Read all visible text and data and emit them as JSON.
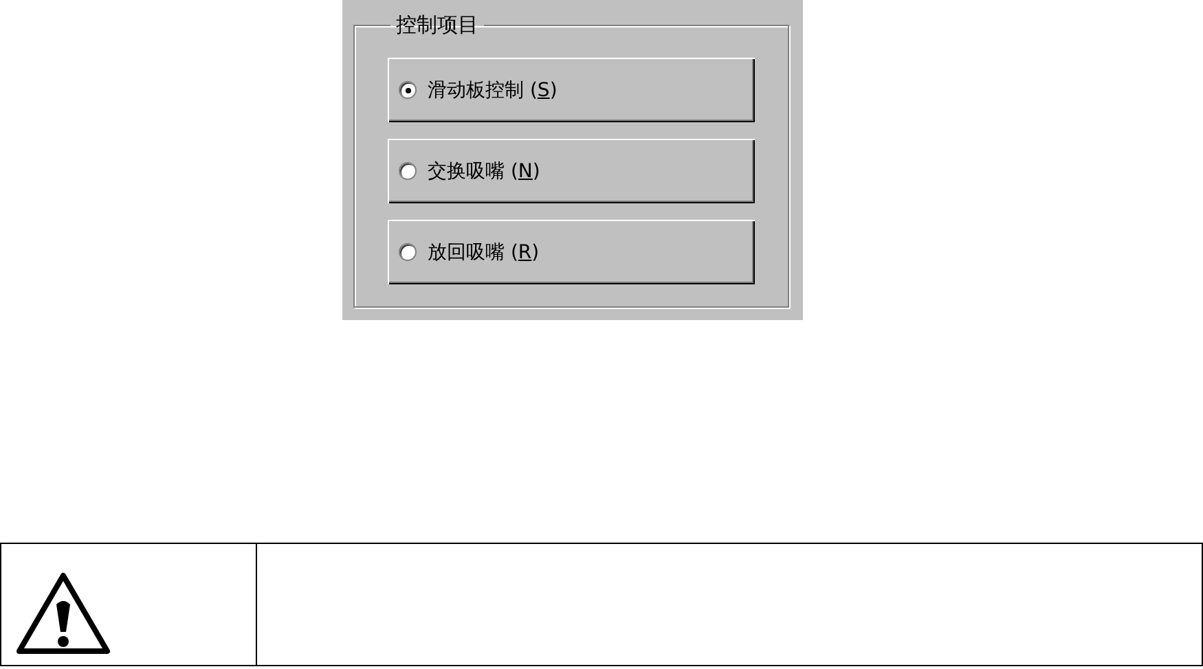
{
  "group_box": {
    "title": "控制项目",
    "options": [
      {
        "text_before": "滑动板控制 (",
        "hotkey": "S",
        "text_after": ")",
        "selected": true
      },
      {
        "text_before": "交换吸嘴 (",
        "hotkey": "N",
        "text_after": ")",
        "selected": false
      },
      {
        "text_before": "放回吸嘴 (",
        "hotkey": "R",
        "text_after": ")",
        "selected": false
      }
    ]
  },
  "warning_table": {
    "kind": "warning"
  }
}
